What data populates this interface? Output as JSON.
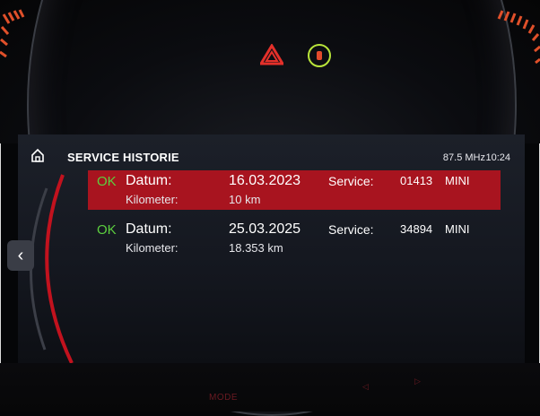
{
  "header": {
    "title": "SERVICE HISTORIE",
    "radio": "87.5 MHz",
    "time": "10:24"
  },
  "entries": [
    {
      "status": "OK",
      "date_label": "Datum:",
      "date": "16.03.2023",
      "km_label": "Kilometer:",
      "km": "10 km",
      "service_label": "Service:",
      "service_no": "01413",
      "brand": "MINI",
      "selected": true
    },
    {
      "status": "OK",
      "date_label": "Datum:",
      "date": "25.03.2025",
      "km_label": "Kilometer:",
      "km": "18.353 km",
      "service_label": "Service:",
      "service_no": "34894",
      "brand": "MINI",
      "selected": false
    }
  ],
  "controls": {
    "mode_label": "MODE",
    "back_icon": "chevron-left-icon",
    "home_icon": "home-icon",
    "hazard_icon": "hazard-warning-icon",
    "seatbelt_icon": "seat-occupancy-icon"
  },
  "colors": {
    "selected_row": "#a8141f",
    "ok_green": "#5ccf3f",
    "accent_orange": "#e0502a"
  }
}
